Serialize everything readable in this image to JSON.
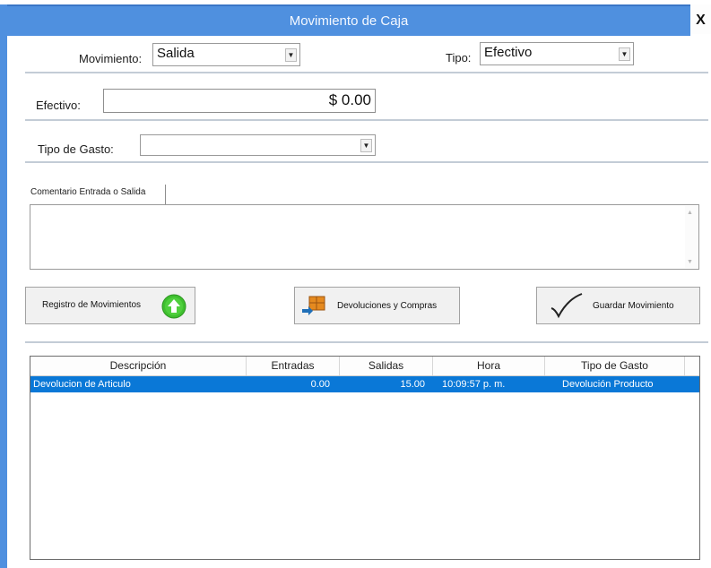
{
  "window": {
    "title": "Movimiento de Caja",
    "close_label": "X"
  },
  "movimiento": {
    "label": "Movimiento:",
    "value": "Salida"
  },
  "tipo": {
    "label": "Tipo:",
    "value": "Efectivo"
  },
  "efectivo": {
    "label": "Efectivo:",
    "value": "$ 0.00"
  },
  "tipo_gasto": {
    "label": "Tipo de Gasto:",
    "value": ""
  },
  "comentario": {
    "tab_label": "Comentario Entrada o Salida",
    "value": ""
  },
  "buttons": {
    "registro": "Registro de Movimientos",
    "devoluciones": "Devoluciones y Compras",
    "guardar": "Guardar Movimiento"
  },
  "table": {
    "columns": [
      "Descripción",
      "Entradas",
      "Salidas",
      "Hora",
      "Tipo de Gasto"
    ],
    "rows": [
      {
        "descripcion": "Devolucion de Articulo",
        "entradas": "0.00",
        "salidas": "15.00",
        "hora": "10:09:57 p. m.",
        "tipo_gasto": "Devolución Producto"
      }
    ]
  },
  "colors": {
    "title_bar": "#4f90df",
    "selected_row": "#0a78d7",
    "icon_green": "#3fbf2f"
  },
  "icons": [
    "close-icon",
    "dropdown-arrow-icon",
    "up-arrow-circle-icon",
    "box-returns-icon",
    "checkmark-icon"
  ]
}
